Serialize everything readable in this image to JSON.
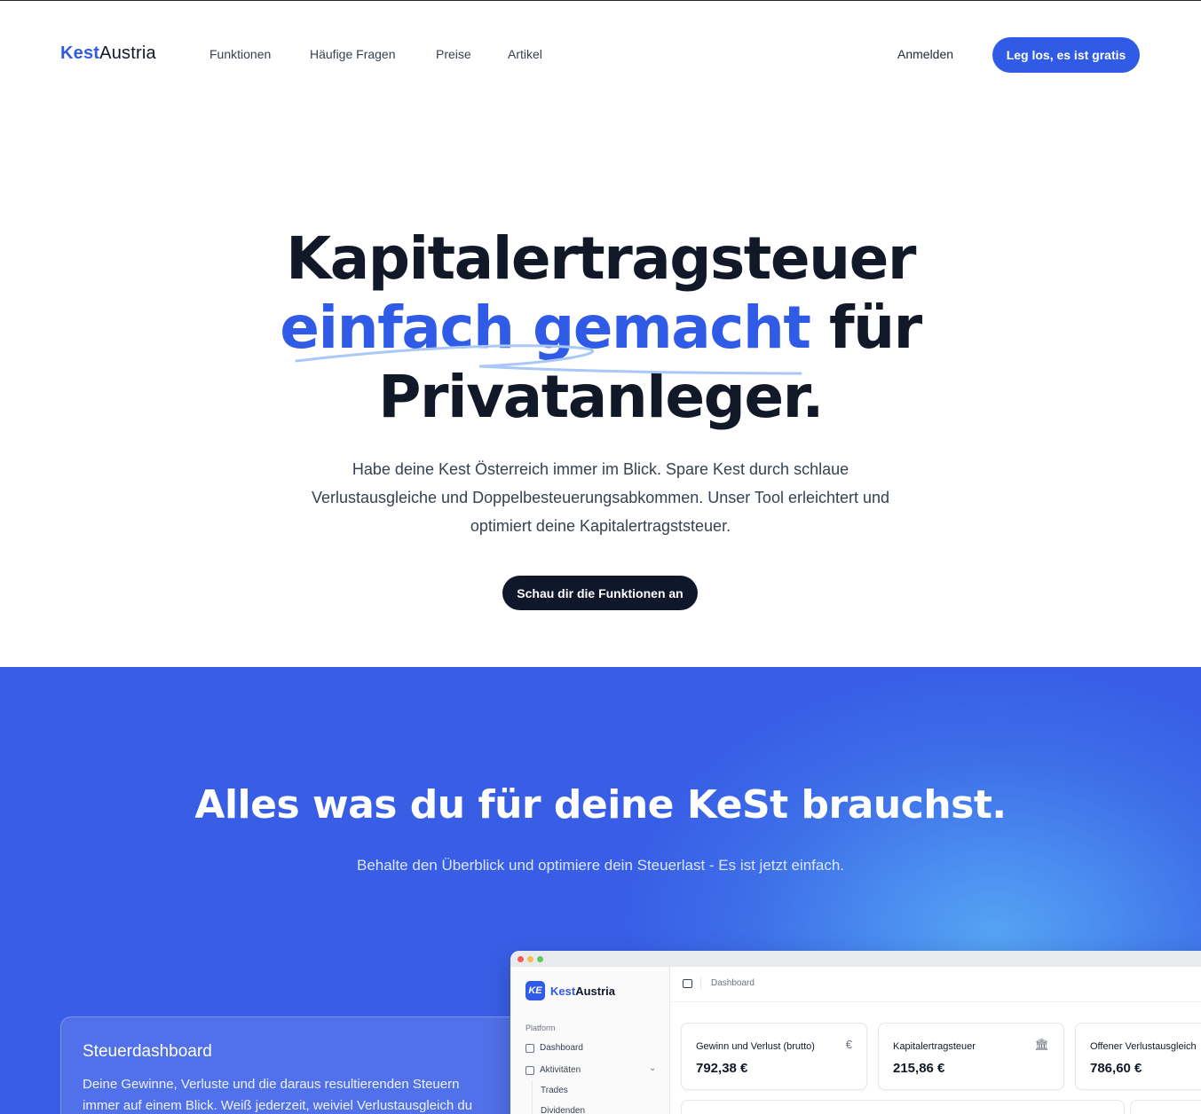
{
  "nav": {
    "logo_kest": "Kest",
    "logo_austria": "Austria",
    "links": [
      "Funktionen",
      "Häufige Fragen",
      "Preise",
      "Artikel"
    ],
    "signin": "Anmelden",
    "cta": "Leg los, es ist gratis"
  },
  "hero": {
    "title_line1": "Kapitalertragsteuer",
    "title_accent": "einfach gemacht",
    "title_rest": " für",
    "title_line3": "Privatanleger.",
    "subtitle": "Habe deine Kest Österreich immer im Blick. Spare Kest durch schlaue Verlustausgleiche und Doppelbesteuerungsabkommen. Unser Tool erleichtert und optimiert deine Kapitalertragststeuer.",
    "cta": "Schau dir die Funktionen an"
  },
  "features": {
    "title": "Alles was du für deine KeSt brauchst.",
    "subtitle": "Behalte den Überblick und optimiere dein Steuerlast - Es ist jetzt einfach.",
    "card": {
      "title": "Steuerdashboard",
      "text": "Deine Gewinne, Verluste und die daraus resultierenden Steuern immer auf einem Blick. Weiß jederzeit, weiviel Verlustausgleich du"
    }
  },
  "app": {
    "logo_badge": "KE",
    "logo_kest": "Kest",
    "logo_austria": "Austria",
    "section": "Platform",
    "items": [
      "Dashboard",
      "Aktivitäten"
    ],
    "subitems": [
      "Trades",
      "Dividenden"
    ],
    "breadcrumb": "Dashboard",
    "kpis": [
      {
        "label": "Gewinn und Verlust (brutto)",
        "value": "792,38 €",
        "icon": "€"
      },
      {
        "label": "Kapitalertragsteuer",
        "value": "215,86 €",
        "icon": "🏛"
      },
      {
        "label": "Offener Verlustausgleich",
        "value": "786,60 €",
        "icon": "€"
      }
    ]
  },
  "colors": {
    "brand": "#2f5be6",
    "dark_button": "#0f172a",
    "section_bg": "#385ee6"
  }
}
